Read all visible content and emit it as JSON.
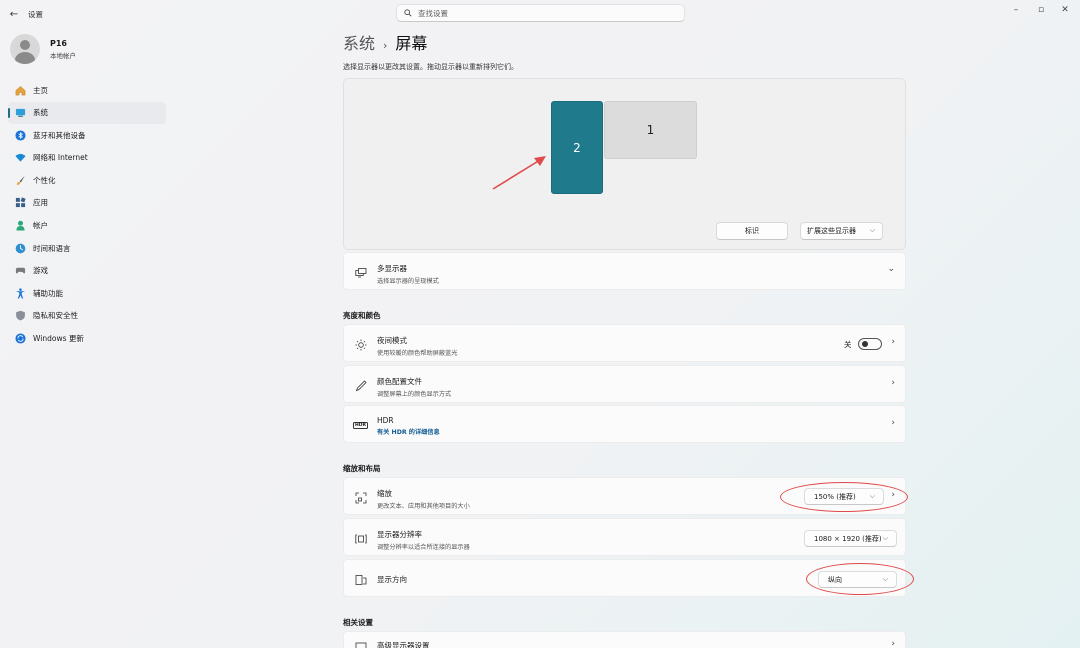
{
  "window": {
    "title": "设置",
    "back": "←",
    "minimize": "–",
    "restore": "▫",
    "close": "✕"
  },
  "search": {
    "placeholder": "查找设置"
  },
  "profile": {
    "name": "P16",
    "account_type": "本地帐户"
  },
  "nav": {
    "items": [
      {
        "label": "主页",
        "icon": "home-icon"
      },
      {
        "label": "系统",
        "icon": "system-icon",
        "active": true
      },
      {
        "label": "蓝牙和其他设备",
        "icon": "bluetooth-icon"
      },
      {
        "label": "网络和 Internet",
        "icon": "wifi-icon"
      },
      {
        "label": "个性化",
        "icon": "brush-icon"
      },
      {
        "label": "应用",
        "icon": "apps-icon"
      },
      {
        "label": "帐户",
        "icon": "account-icon"
      },
      {
        "label": "时间和语言",
        "icon": "globe-clock-icon"
      },
      {
        "label": "游戏",
        "icon": "gamepad-icon"
      },
      {
        "label": "辅助功能",
        "icon": "accessibility-icon"
      },
      {
        "label": "隐私和安全性",
        "icon": "shield-icon"
      },
      {
        "label": "Windows 更新",
        "icon": "update-icon"
      }
    ]
  },
  "breadcrumb": {
    "parent": "系统",
    "separator": "›",
    "current": "屏幕"
  },
  "arrange": {
    "hint": "选择显示器以更改其设置。拖动显示器以重新排列它们。",
    "monitor_2": "2",
    "monitor_1": "1",
    "identify_button": "标识",
    "extend_select": "扩展这些显示器",
    "caret": "⌵"
  },
  "multi_display": {
    "title": "多显示器",
    "subtitle": "选择显示器的呈现模式",
    "chevron": "⌄"
  },
  "brightness_section": {
    "heading": "亮度和颜色"
  },
  "night_light": {
    "title": "夜间模式",
    "subtitle": "使用较暖的颜色帮助屏蔽蓝光",
    "state": "关",
    "chevron": "›"
  },
  "color_profile": {
    "title": "颜色配置文件",
    "subtitle": "调整屏幕上的颜色显示方式",
    "chevron": "›"
  },
  "hdr": {
    "title": "HDR",
    "subtitle": "有关 HDR 的详细信息",
    "icon_text": "HDR",
    "chevron": "›"
  },
  "scale_section": {
    "heading": "缩放和布局"
  },
  "scale": {
    "title": "缩放",
    "subtitle": "更改文本、应用和其他项目的大小",
    "value": "150% (推荐)",
    "caret": "⌵",
    "chevron": "›"
  },
  "resolution": {
    "title": "显示器分辨率",
    "subtitle": "调整分辨率以适合所连接的显示器",
    "value": "1080 × 1920 (推荐)",
    "caret": "⌵"
  },
  "orientation": {
    "title": "显示方向",
    "value": "纵向",
    "caret": "⌵"
  },
  "related_section": {
    "heading": "相关设置"
  },
  "advanced_display": {
    "title": "高级显示器设置",
    "chevron": "›"
  },
  "colors": {
    "accent": "#1f7a8c",
    "annotation": "#e04a4a"
  }
}
